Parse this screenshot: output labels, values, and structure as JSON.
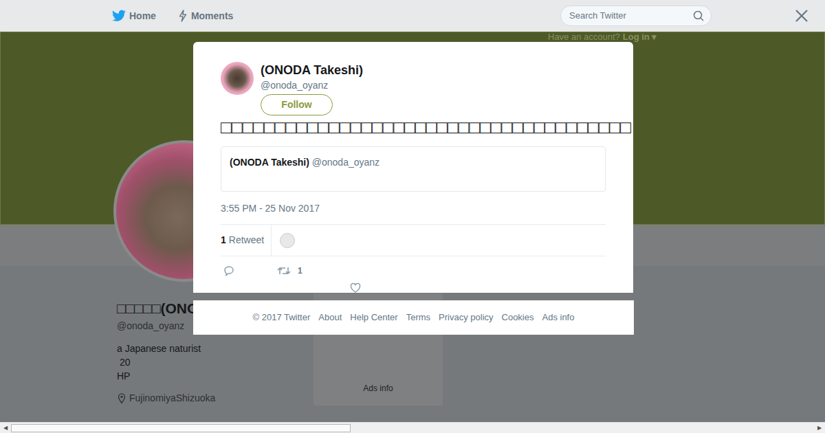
{
  "nav": {
    "items": [
      {
        "label": "Home"
      },
      {
        "label": "Moments"
      }
    ],
    "search": {
      "placeholder": "Search Twitter"
    },
    "account": {
      "prompt": "Have an account?",
      "login": "Log in"
    }
  },
  "profile": {
    "name": "□□□□□(ONODA Takeshi)",
    "handle": "@onoda_oyanz",
    "bio": [
      "a Japanese naturist",
      " 20",
      "HP"
    ],
    "location": "FujinomiyaShizuoka"
  },
  "sidebar": {
    "ads": "Ads info"
  },
  "tweet": {
    "name": "(ONODA Takeshi)",
    "handle": "@onoda_oyanz",
    "follow": "Follow",
    "text": "□□□□□□□□□□□□□□□□□□□□□□□□□□□□□□□□□□□□□□",
    "quote": {
      "name": "(ONODA Takeshi)",
      "handle": "@onoda_oyanz"
    },
    "timestamp": "3:55 PM - 25 Nov 2017",
    "retweets": {
      "count": "1",
      "label": "Retweet"
    },
    "actions": {
      "retweet_count": "1",
      "liked": false
    }
  },
  "footer": {
    "links": [
      "© 2017 Twitter",
      "About",
      "Help Center",
      "Terms",
      "Privacy policy",
      "Cookies",
      "Ads info"
    ]
  }
}
